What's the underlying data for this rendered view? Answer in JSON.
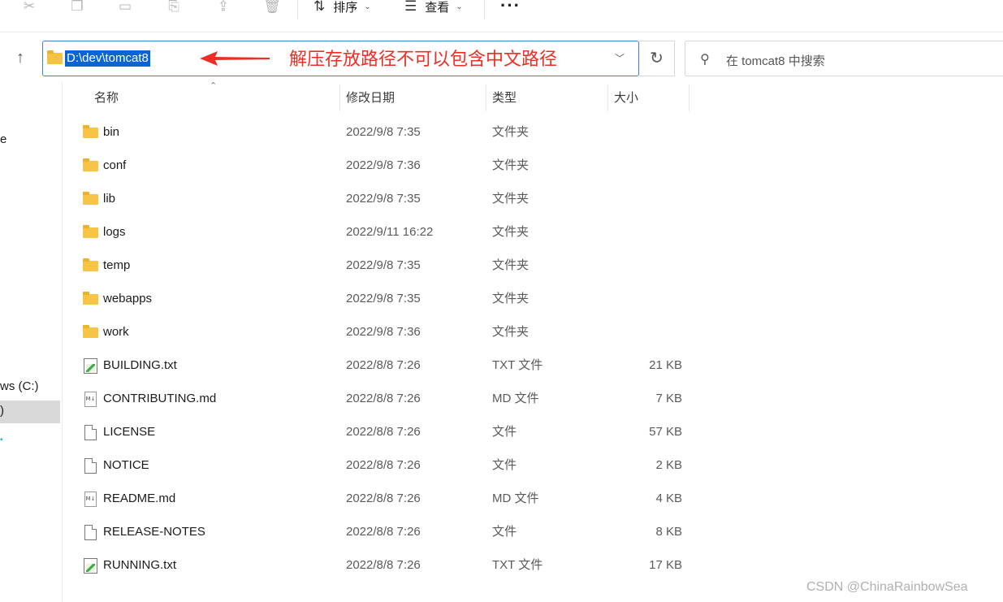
{
  "toolbar": {
    "sort_label": "排序",
    "view_label": "查看",
    "more_label": "···",
    "icons": [
      "cut-icon",
      "copy-icon",
      "paste-icon",
      "rename-icon",
      "share-icon",
      "delete-icon"
    ]
  },
  "address_bar": {
    "path": "D:\\dev\\tomcat8"
  },
  "search": {
    "placeholder": "在 tomcat8 中搜索"
  },
  "annotation": {
    "text": "解压存放路径不可以包含中文路径",
    "color": "#ee2e24"
  },
  "sidebar": {
    "partial_top": "e",
    "drive_label": "ws (C:)",
    "selected_label": ")"
  },
  "columns": {
    "name": "名称",
    "date": "修改日期",
    "type": "类型",
    "size": "大小"
  },
  "files": [
    {
      "name": "bin",
      "date": "2022/9/8 7:35",
      "type": "文件夹",
      "size": "",
      "icon": "folder-icon"
    },
    {
      "name": "conf",
      "date": "2022/9/8 7:36",
      "type": "文件夹",
      "size": "",
      "icon": "folder-icon"
    },
    {
      "name": "lib",
      "date": "2022/9/8 7:35",
      "type": "文件夹",
      "size": "",
      "icon": "folder-icon"
    },
    {
      "name": "logs",
      "date": "2022/9/11 16:22",
      "type": "文件夹",
      "size": "",
      "icon": "folder-icon"
    },
    {
      "name": "temp",
      "date": "2022/9/8 7:35",
      "type": "文件夹",
      "size": "",
      "icon": "folder-icon"
    },
    {
      "name": "webapps",
      "date": "2022/9/8 7:35",
      "type": "文件夹",
      "size": "",
      "icon": "folder-icon"
    },
    {
      "name": "work",
      "date": "2022/9/8 7:36",
      "type": "文件夹",
      "size": "",
      "icon": "folder-icon"
    },
    {
      "name": "BUILDING.txt",
      "date": "2022/8/8 7:26",
      "type": "TXT 文件",
      "size": "21 KB",
      "icon": "text-file-icon"
    },
    {
      "name": "CONTRIBUTING.md",
      "date": "2022/8/8 7:26",
      "type": "MD 文件",
      "size": "7 KB",
      "icon": "markdown-file-icon"
    },
    {
      "name": "LICENSE",
      "date": "2022/8/8 7:26",
      "type": "文件",
      "size": "57 KB",
      "icon": "file-icon"
    },
    {
      "name": "NOTICE",
      "date": "2022/8/8 7:26",
      "type": "文件",
      "size": "2 KB",
      "icon": "file-icon"
    },
    {
      "name": "README.md",
      "date": "2022/8/8 7:26",
      "type": "MD 文件",
      "size": "4 KB",
      "icon": "markdown-file-icon"
    },
    {
      "name": "RELEASE-NOTES",
      "date": "2022/8/8 7:26",
      "type": "文件",
      "size": "8 KB",
      "icon": "file-icon"
    },
    {
      "name": "RUNNING.txt",
      "date": "2022/8/8 7:26",
      "type": "TXT 文件",
      "size": "17 KB",
      "icon": "text-file-icon"
    }
  ],
  "watermark": "CSDN @ChinaRainbowSea"
}
